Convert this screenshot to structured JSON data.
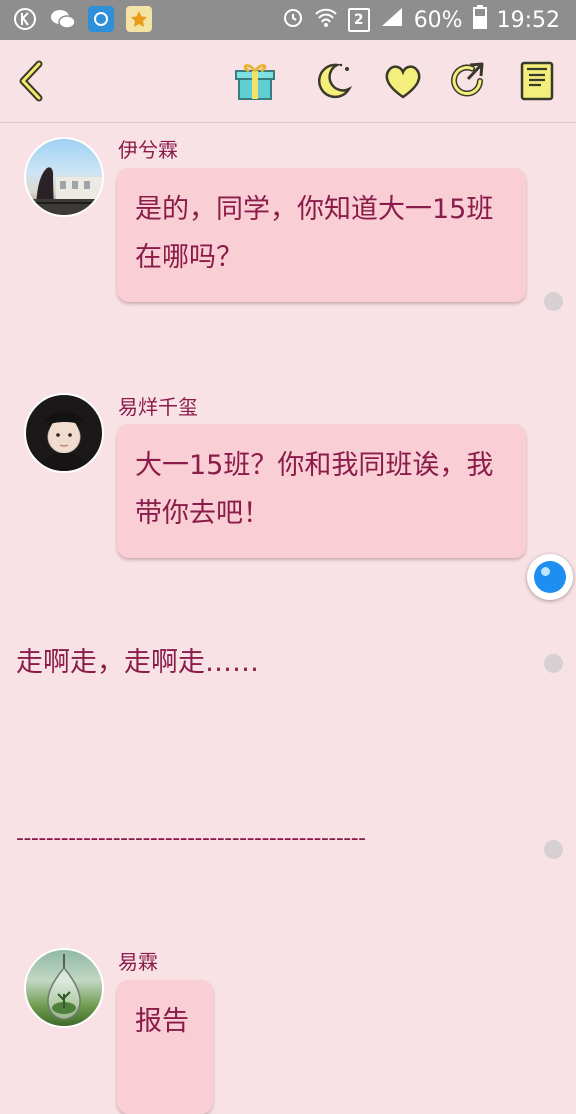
{
  "status_bar": {
    "notification_icons": [
      "k-app-icon",
      "wechat-icon",
      "browser-icon",
      "star-app-icon"
    ],
    "sim_slot": "2",
    "battery": "60%",
    "time": "19:52"
  },
  "toolbar": {
    "icons": [
      "back-icon",
      "gift-icon",
      "night-mode-icon",
      "favorite-icon",
      "share-icon",
      "notes-icon"
    ]
  },
  "messages": [
    {
      "sender": "伊兮霖",
      "text": "是的，同学，你知道大一15班在哪吗？"
    },
    {
      "sender": "易烊千玺",
      "text": "大一15班？你和我同班诶，我带你去吧！"
    },
    {
      "sender": "易霖",
      "text": "报告"
    }
  ],
  "narration": "走啊走，走啊走……",
  "divider": "-----------------------------------------------"
}
